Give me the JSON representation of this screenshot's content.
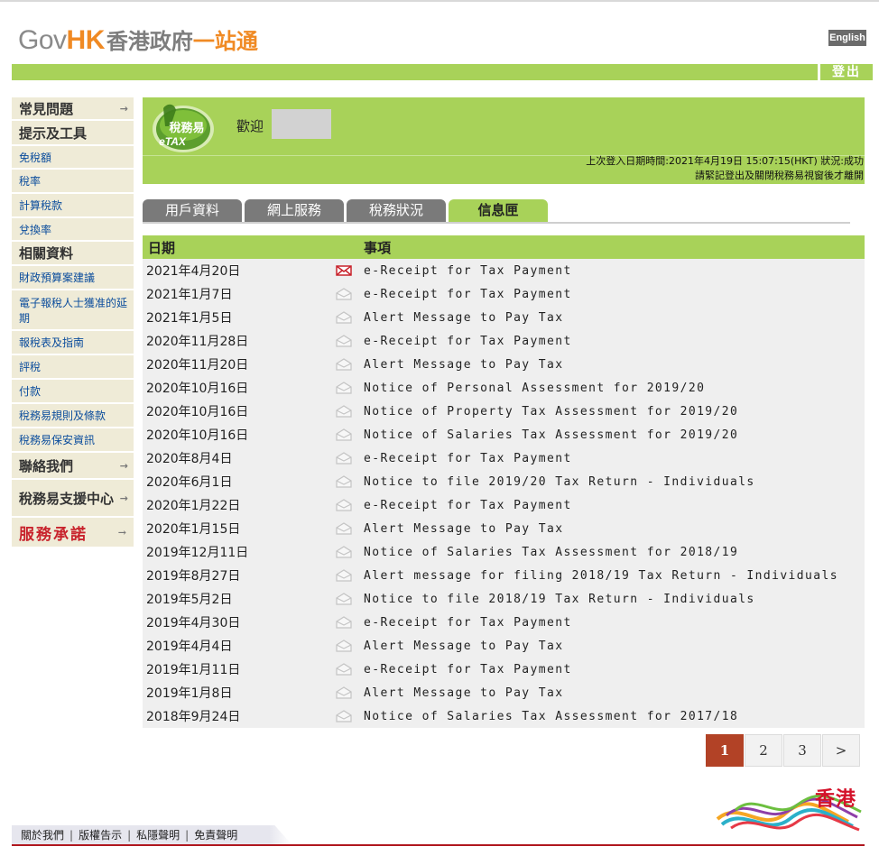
{
  "header": {
    "logo_gov": "Gov",
    "logo_hk": "HK",
    "logo_zh1": "香港政府",
    "logo_zh2": "一站通",
    "language_button": "English",
    "logout_button": "登出"
  },
  "sidebar": {
    "items": [
      {
        "label": "常見問題",
        "type": "head",
        "arrow": true
      },
      {
        "label": "提示及工具",
        "type": "head",
        "arrow": false
      },
      {
        "label": "免稅額",
        "type": "link"
      },
      {
        "label": "稅率",
        "type": "link"
      },
      {
        "label": "計算稅款",
        "type": "link"
      },
      {
        "label": "兌換率",
        "type": "link"
      },
      {
        "label": "相關資料",
        "type": "head",
        "arrow": false
      },
      {
        "label": "財政預算案建議",
        "type": "link"
      },
      {
        "label": "電子報稅人士獲准的延期",
        "type": "link"
      },
      {
        "label": "報稅表及指南",
        "type": "link"
      },
      {
        "label": "評稅",
        "type": "link"
      },
      {
        "label": "付款",
        "type": "link"
      },
      {
        "label": "稅務易規則及條款",
        "type": "link"
      },
      {
        "label": "稅務易保安資訊",
        "type": "link"
      },
      {
        "label": "聯絡我們",
        "type": "head",
        "arrow": true
      },
      {
        "label": "稅務易支援中心",
        "type": "head",
        "arrow": true
      },
      {
        "label": "服務承諾",
        "type": "brand",
        "arrow": true
      }
    ]
  },
  "etax": {
    "logo_zh": "稅務易",
    "logo_en": "eTAX",
    "welcome": "歡迎",
    "last_login": "上次登入日期時間:2021年4月19日 15:07:15(HKT) 狀況:成功",
    "reminder": "請緊記登出及關閉稅務易視窗後才離開"
  },
  "tabs": [
    {
      "label": "用戶資料",
      "active": false
    },
    {
      "label": "網上服務",
      "active": false
    },
    {
      "label": "稅務狀況",
      "active": false
    },
    {
      "label": "信息匣",
      "active": true
    }
  ],
  "table": {
    "headers": {
      "date": "日期",
      "item": "事項"
    },
    "rows": [
      {
        "date": "2021年4月20日",
        "item": "e-Receipt for Tax Payment",
        "unread": true
      },
      {
        "date": "2021年1月7日",
        "item": "e-Receipt for Tax Payment",
        "unread": false
      },
      {
        "date": "2021年1月5日",
        "item": "Alert Message to Pay Tax",
        "unread": false
      },
      {
        "date": "2020年11月28日",
        "item": "e-Receipt for Tax Payment",
        "unread": false
      },
      {
        "date": "2020年11月20日",
        "item": "Alert Message to Pay Tax",
        "unread": false
      },
      {
        "date": "2020年10月16日",
        "item": "Notice of Personal Assessment for 2019/20",
        "unread": false
      },
      {
        "date": "2020年10月16日",
        "item": "Notice of Property Tax Assessment for 2019/20",
        "unread": false
      },
      {
        "date": "2020年10月16日",
        "item": "Notice of Salaries Tax Assessment for 2019/20",
        "unread": false
      },
      {
        "date": "2020年8月4日",
        "item": "e-Receipt for Tax Payment",
        "unread": false
      },
      {
        "date": "2020年6月1日",
        "item": "Notice to file 2019/20 Tax Return - Individuals",
        "unread": false
      },
      {
        "date": "2020年1月22日",
        "item": "e-Receipt for Tax Payment",
        "unread": false
      },
      {
        "date": "2020年1月15日",
        "item": "Alert Message to Pay Tax",
        "unread": false
      },
      {
        "date": "2019年12月11日",
        "item": "Notice of Salaries Tax Assessment for 2018/19",
        "unread": false
      },
      {
        "date": "2019年8月27日",
        "item": "Alert message for filing 2018/19 Tax Return - Individuals",
        "unread": false
      },
      {
        "date": "2019年5月2日",
        "item": "Notice to file 2018/19 Tax Return - Individuals",
        "unread": false
      },
      {
        "date": "2019年4月30日",
        "item": "e-Receipt for Tax Payment",
        "unread": false
      },
      {
        "date": "2019年4月4日",
        "item": "Alert Message to Pay Tax",
        "unread": false
      },
      {
        "date": "2019年1月11日",
        "item": "e-Receipt for Tax Payment",
        "unread": false
      },
      {
        "date": "2019年1月8日",
        "item": "Alert Message to Pay Tax",
        "unread": false
      },
      {
        "date": "2018年9月24日",
        "item": "Notice of Salaries Tax Assessment for 2017/18",
        "unread": false
      }
    ]
  },
  "pagination": {
    "pages": [
      "1",
      "2",
      "3",
      ">"
    ],
    "current": "1"
  },
  "footer": {
    "links": [
      "關於我們",
      "版權告示",
      "私隱聲明",
      "免責聲明"
    ],
    "brand": "香港"
  },
  "colors": {
    "accent_green": "#a8d259",
    "tab_grey": "#7a7a7a",
    "pager_active": "#b24226",
    "unread_mail": "#c8232c",
    "brand_red": "#d4122a"
  }
}
